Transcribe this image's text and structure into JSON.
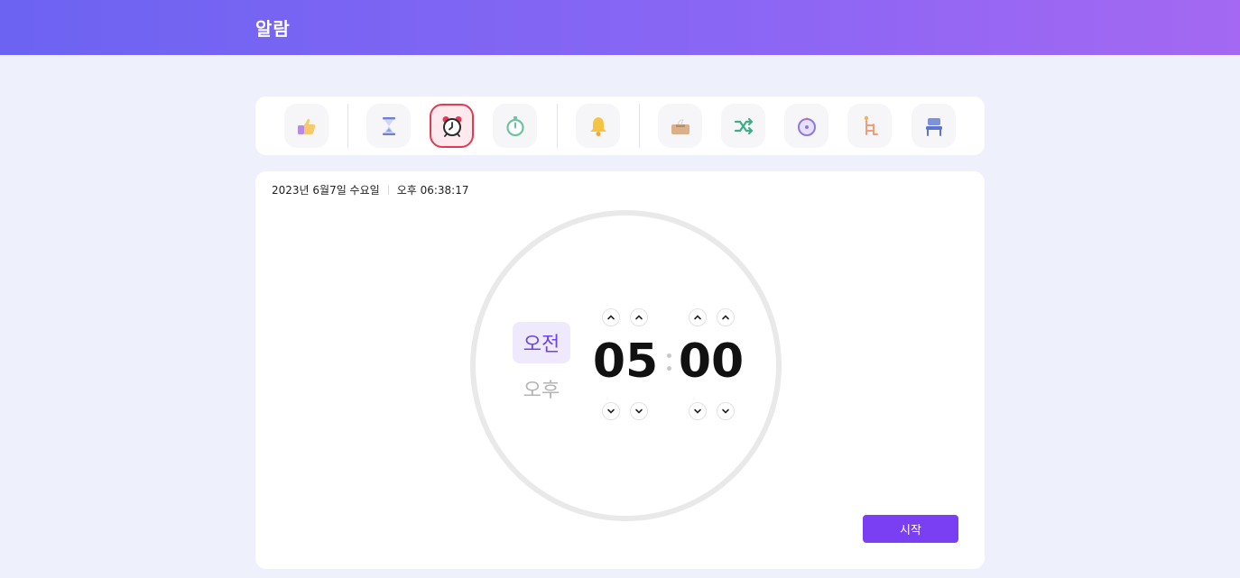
{
  "header": {
    "title": "알람"
  },
  "toolbar": {
    "tools": [
      {
        "icon": "thumbs-up-icon"
      },
      {
        "icon": "hourglass-icon"
      },
      {
        "icon": "alarm-clock-icon",
        "active": true
      },
      {
        "icon": "stopwatch-icon"
      },
      {
        "icon": "bell-icon"
      },
      {
        "icon": "tissue-box-icon"
      },
      {
        "icon": "shuffle-icon"
      },
      {
        "icon": "compass-clock-icon"
      },
      {
        "icon": "ladder-icon"
      },
      {
        "icon": "chair-icon"
      }
    ]
  },
  "card": {
    "date": "2023년 6월7일 수요일",
    "time": "오후 06:38:17",
    "am_label": "오전",
    "pm_label": "오후",
    "hours": "05",
    "minutes": "00",
    "start_label": "시작"
  },
  "colors": {
    "accent": "#7a3ff2",
    "active_border": "#e33a52",
    "header_start": "#6c63f2",
    "header_end": "#a468f2"
  }
}
